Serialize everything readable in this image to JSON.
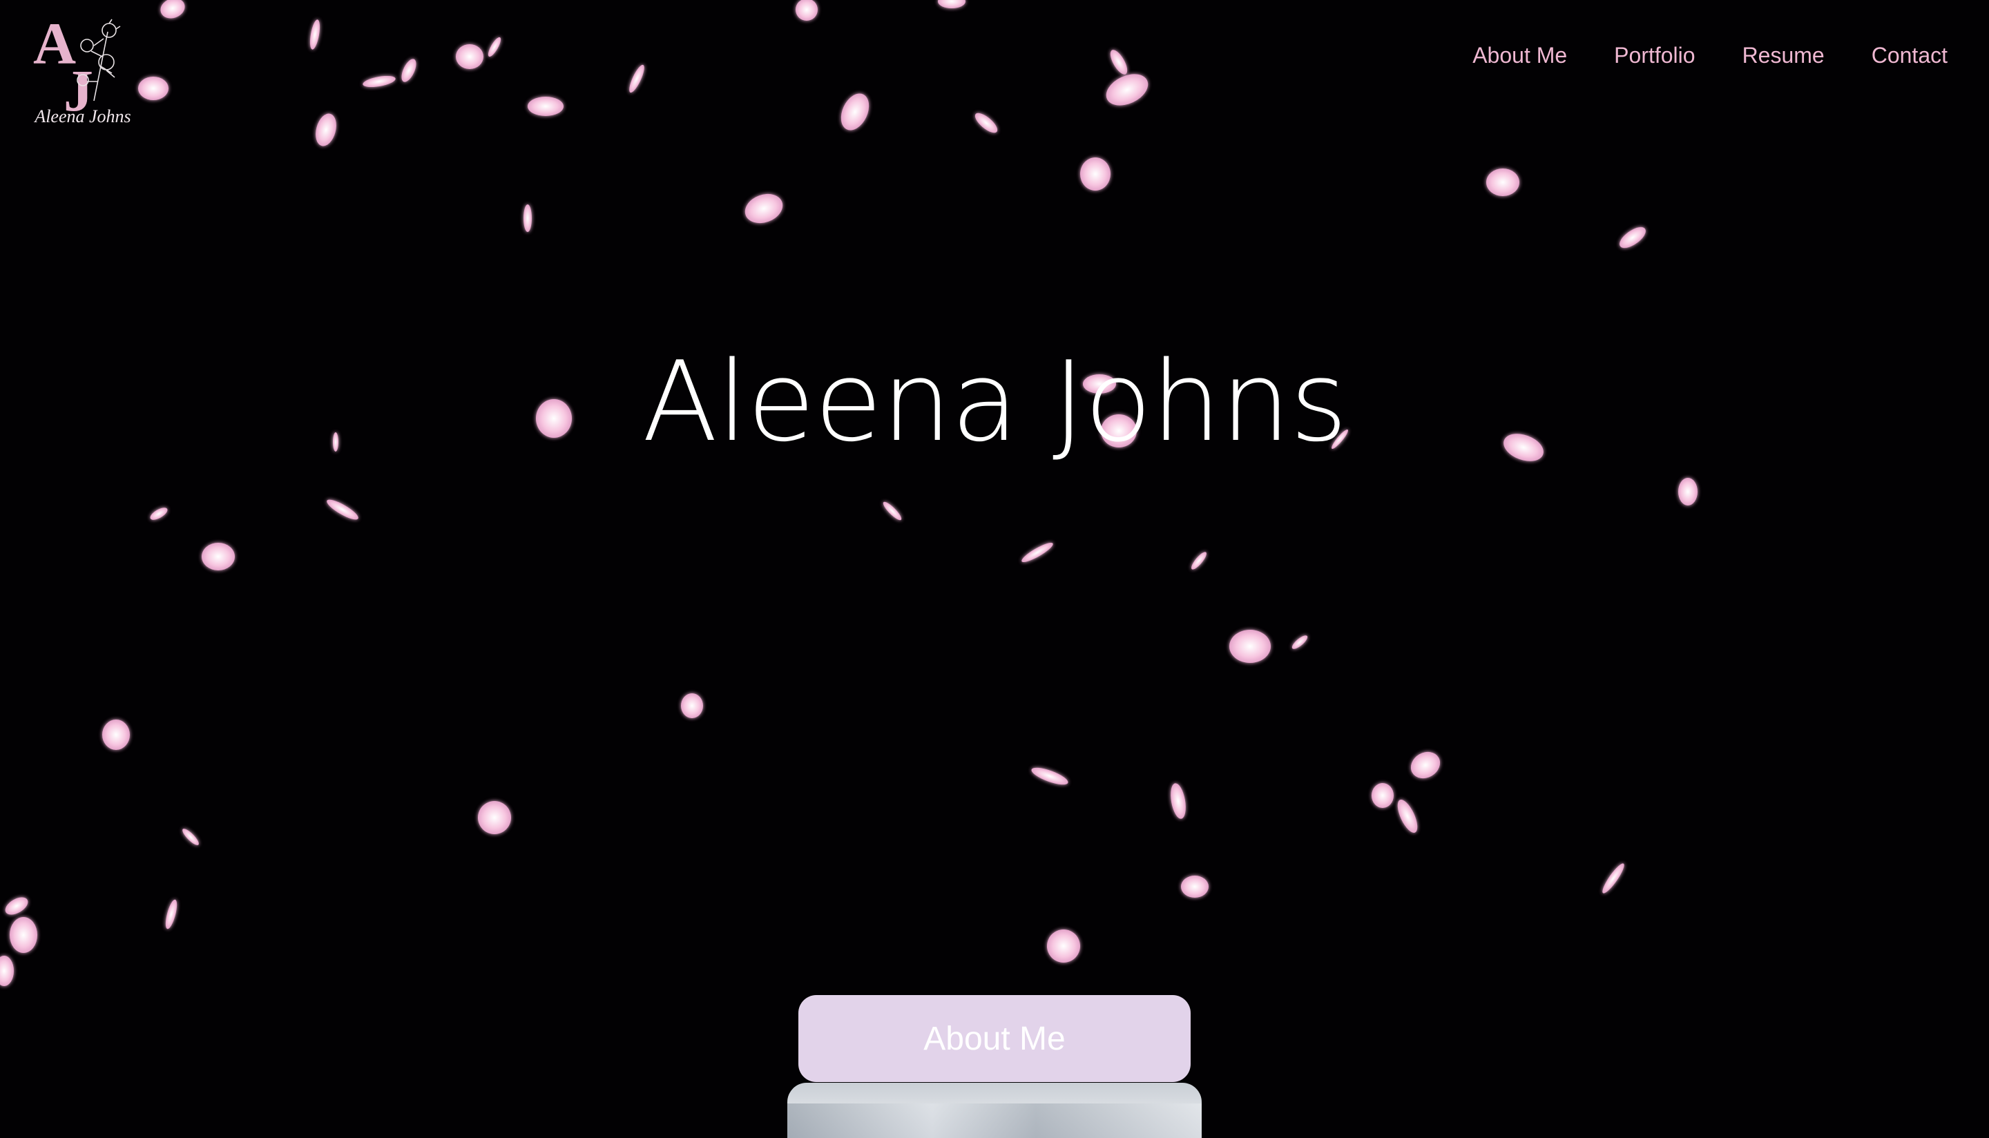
{
  "logo": {
    "letters_a": "A",
    "letters_j": "J",
    "script": "Aleena Johns",
    "accent": "#e6b3cc"
  },
  "nav": {
    "items": [
      {
        "label": "About Me"
      },
      {
        "label": "Portfolio"
      },
      {
        "label": "Resume"
      },
      {
        "label": "Contact"
      }
    ],
    "color": "#efb8d2"
  },
  "hero": {
    "title": "Aleena Johns",
    "background": "#020103",
    "decoration": "falling-cherry-blossom-petals",
    "petal_color": "#f3b9d8"
  },
  "about": {
    "button_label": "About Me",
    "button_color": "#e2d3ea"
  }
}
